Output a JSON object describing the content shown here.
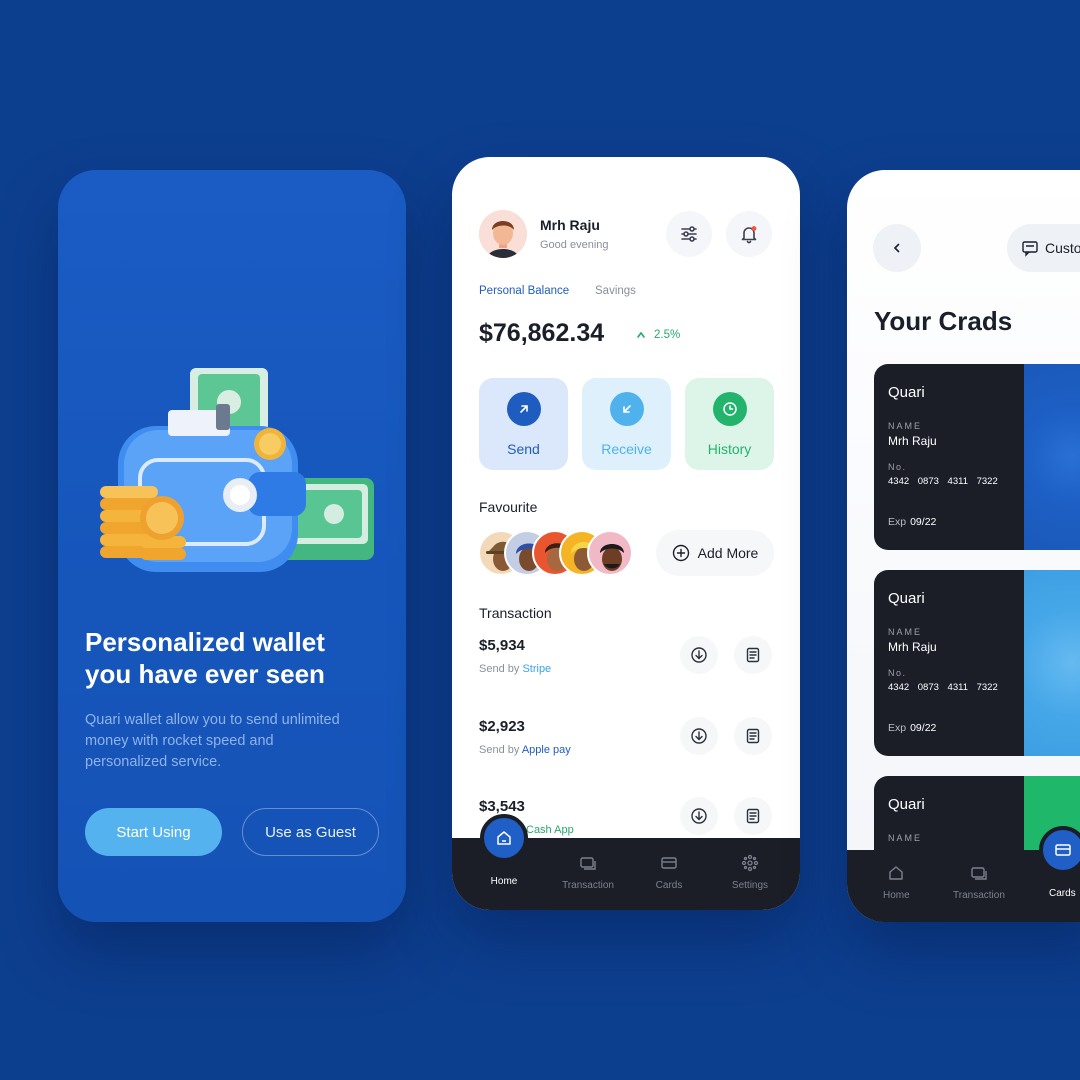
{
  "colors": {
    "background": "#0d3f8f",
    "primary": "#1f5fc6",
    "accent_light": "#54b3ee",
    "success": "#25a86e",
    "dark": "#1b1e27"
  },
  "onboarding": {
    "headline": "Personalized wallet\nyou have ever seen",
    "description": "Quari wallet allow you to send unlimited money with rocket speed and personalized service.",
    "start_label": "Start Using",
    "guest_label": "Use as Guest"
  },
  "home": {
    "user_name": "Mrh Raju",
    "greeting": "Good evening",
    "tabs": [
      "Personal Balance",
      "Savings"
    ],
    "balance": "$76,862.34",
    "trend": "2.5%",
    "actions": [
      {
        "label": "Send",
        "icon": "arrow-up-right-icon"
      },
      {
        "label": "Receive",
        "icon": "arrow-down-left-icon"
      },
      {
        "label": "History",
        "icon": "clock-icon"
      }
    ],
    "favourite_title": "Favourite",
    "add_more_label": "Add More",
    "transaction_title": "Transaction",
    "transactions": [
      {
        "amount": "$5,934",
        "prefix": "Send by",
        "via": "Stripe",
        "via_color": "#3aa3e6"
      },
      {
        "amount": "$2,923",
        "prefix": "Send by",
        "via": "Apple pay",
        "via_color": "#1f5cc0"
      },
      {
        "amount": "$3,543",
        "prefix": "",
        "via": "Cash App",
        "via_color": "#25a86e"
      }
    ],
    "nav": [
      "Home",
      "Transaction",
      "Cards",
      "Settings"
    ]
  },
  "cards_screen": {
    "title": "Your Crads",
    "custom_label": "Custo",
    "cards": [
      {
        "brand": "Quari",
        "name_key": "NAME",
        "name": "Mrh Raju",
        "no_key": "No.",
        "number": "4342 0873 4311 7322",
        "exp_key": "Exp",
        "exp": "09/22",
        "accent": "#1d5fc4"
      },
      {
        "brand": "Quari",
        "name_key": "NAME",
        "name": "Mrh Raju",
        "no_key": "No.",
        "number": "4342 0873 4311 7322",
        "exp_key": "Exp",
        "exp": "09/22",
        "accent": "#46a7e8"
      },
      {
        "brand": "Quari",
        "name_key": "NAME",
        "name": "",
        "no_key": "",
        "number": "",
        "exp_key": "",
        "exp": "",
        "accent": "#1fb86a"
      }
    ],
    "nav": [
      "Home",
      "Transaction",
      "Cards"
    ]
  }
}
